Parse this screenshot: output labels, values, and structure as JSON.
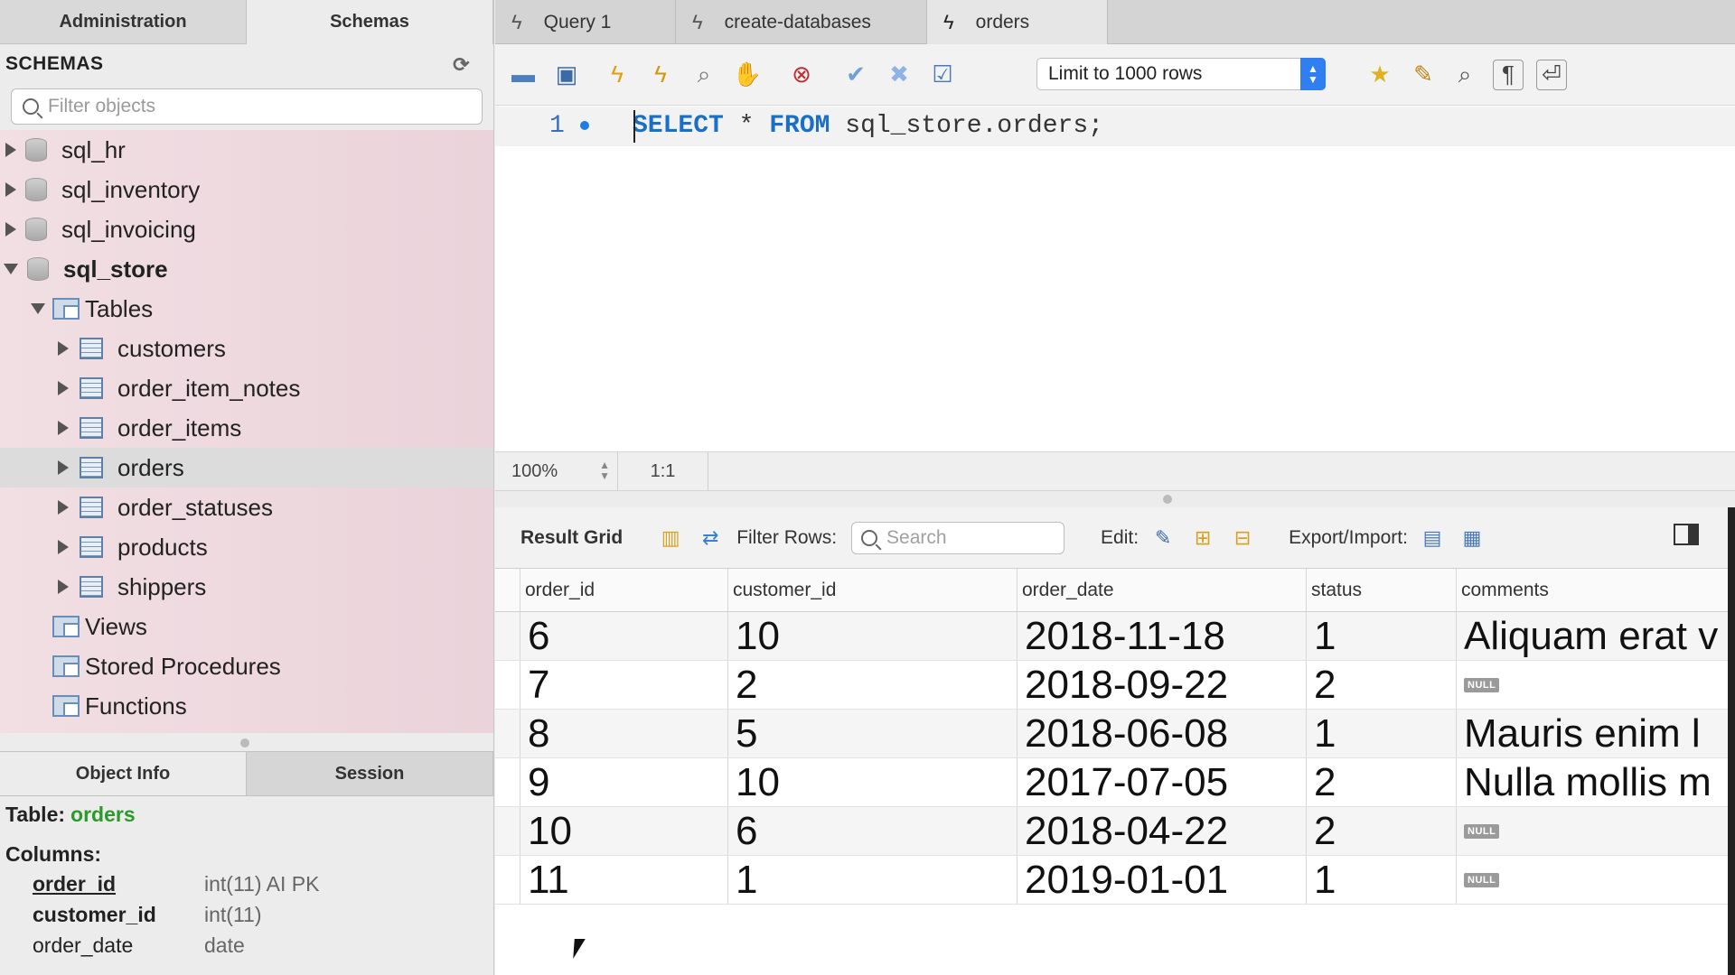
{
  "left_tabs": [
    "Administration",
    "Schemas"
  ],
  "schemas": {
    "header": "SCHEMAS",
    "filter_placeholder": "Filter objects",
    "tree": [
      {
        "label": "sql_hr"
      },
      {
        "label": "sql_inventory"
      },
      {
        "label": "sql_invoicing"
      },
      {
        "label": "sql_store"
      },
      {
        "label": "Tables"
      },
      {
        "label": "customers"
      },
      {
        "label": "order_item_notes"
      },
      {
        "label": "order_items"
      },
      {
        "label": "orders"
      },
      {
        "label": "order_statuses"
      },
      {
        "label": "products"
      },
      {
        "label": "shippers"
      },
      {
        "label": "Views"
      },
      {
        "label": "Stored Procedures"
      },
      {
        "label": "Functions"
      }
    ]
  },
  "info_tabs": [
    "Object Info",
    "Session"
  ],
  "object_info": {
    "table_label": "Table:",
    "table_name": "orders",
    "columns_label": "Columns:",
    "columns": [
      {
        "name": "order_id",
        "type": "int(11) AI PK"
      },
      {
        "name": "customer_id",
        "type": "int(11)"
      },
      {
        "name": "order_date",
        "type": "date"
      }
    ]
  },
  "query_tabs": [
    "Query 1",
    "create-databases",
    "orders"
  ],
  "toolbar": {
    "limit": "Limit to 1000 rows"
  },
  "editor": {
    "line_number": "1",
    "kw_select": "SELECT",
    "star": " * ",
    "kw_from": "FROM",
    "rest": " sql_store.orders;"
  },
  "status": {
    "zoom": "100%",
    "position": "1:1"
  },
  "result_bar": {
    "title": "Result Grid",
    "filter_label": "Filter Rows:",
    "search_placeholder": "Search",
    "edit_label": "Edit:",
    "export_label": "Export/Import:"
  },
  "grid": {
    "columns": [
      "order_id",
      "customer_id",
      "order_date",
      "status",
      "comments"
    ],
    "rows": [
      [
        "6",
        "10",
        "2018-11-18",
        "1",
        "Aliquam erat v"
      ],
      [
        "7",
        "2",
        "2018-09-22",
        "2",
        "NULL"
      ],
      [
        "8",
        "5",
        "2018-06-08",
        "1",
        "Mauris enim l"
      ],
      [
        "9",
        "10",
        "2017-07-05",
        "2",
        "Nulla mollis m"
      ],
      [
        "10",
        "6",
        "2018-04-22",
        "2",
        "NULL"
      ],
      [
        "11",
        "1",
        "2019-01-01",
        "1",
        "NULL"
      ]
    ]
  }
}
